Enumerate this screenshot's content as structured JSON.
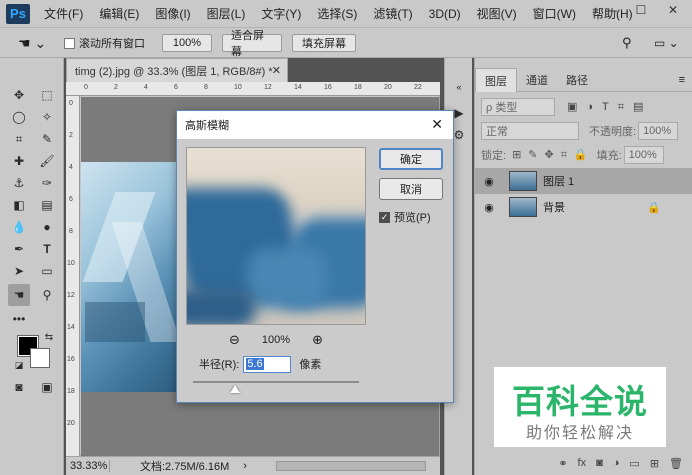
{
  "app": {
    "logo": "Ps"
  },
  "menu": [
    "文件(F)",
    "编辑(E)",
    "图像(I)",
    "图层(L)",
    "文字(Y)",
    "选择(S)",
    "滤镜(T)",
    "3D(D)",
    "视图(V)",
    "窗口(W)",
    "帮助(H)"
  ],
  "options": {
    "scroll_all": "滚动所有窗口",
    "zoom_value": "100%",
    "fit_screen": "适合屏幕",
    "fill_screen": "填充屏幕"
  },
  "document": {
    "tab_title": "timg (2).jpg @ 33.3% (图层 1, RGB/8#) *",
    "zoom": "33.33%",
    "doc_info": "文档:2.75M/6.16M"
  },
  "ruler": {
    "h_labels": [
      "0",
      "2",
      "4",
      "6",
      "8",
      "10",
      "12",
      "14",
      "16",
      "18",
      "20",
      "22"
    ],
    "v_labels": [
      "0",
      "2",
      "4",
      "6",
      "8",
      "10",
      "12",
      "14",
      "16",
      "18",
      "20"
    ]
  },
  "panel": {
    "tabs": [
      "图层",
      "通道",
      "路径"
    ],
    "kind_label": "ρ 类型",
    "blend_mode": "正常",
    "opacity_label": "不透明度:",
    "opacity_value": "100%",
    "lock_label": "锁定:",
    "fill_label": "填充:",
    "fill_value": "100%",
    "layers": [
      {
        "name": "图层 1",
        "selected": true
      },
      {
        "name": "背景",
        "selected": false
      }
    ]
  },
  "dialog": {
    "title": "高斯模糊",
    "ok": "确定",
    "cancel": "取消",
    "preview_label": "预览(P)",
    "zoom_percent": "100%",
    "radius_label": "半径(R):",
    "radius_value": "5.6",
    "unit": "像素",
    "radius_fraction": 0.25
  },
  "watermark": {
    "main": "百科全说",
    "sub": "助你轻松解决"
  }
}
